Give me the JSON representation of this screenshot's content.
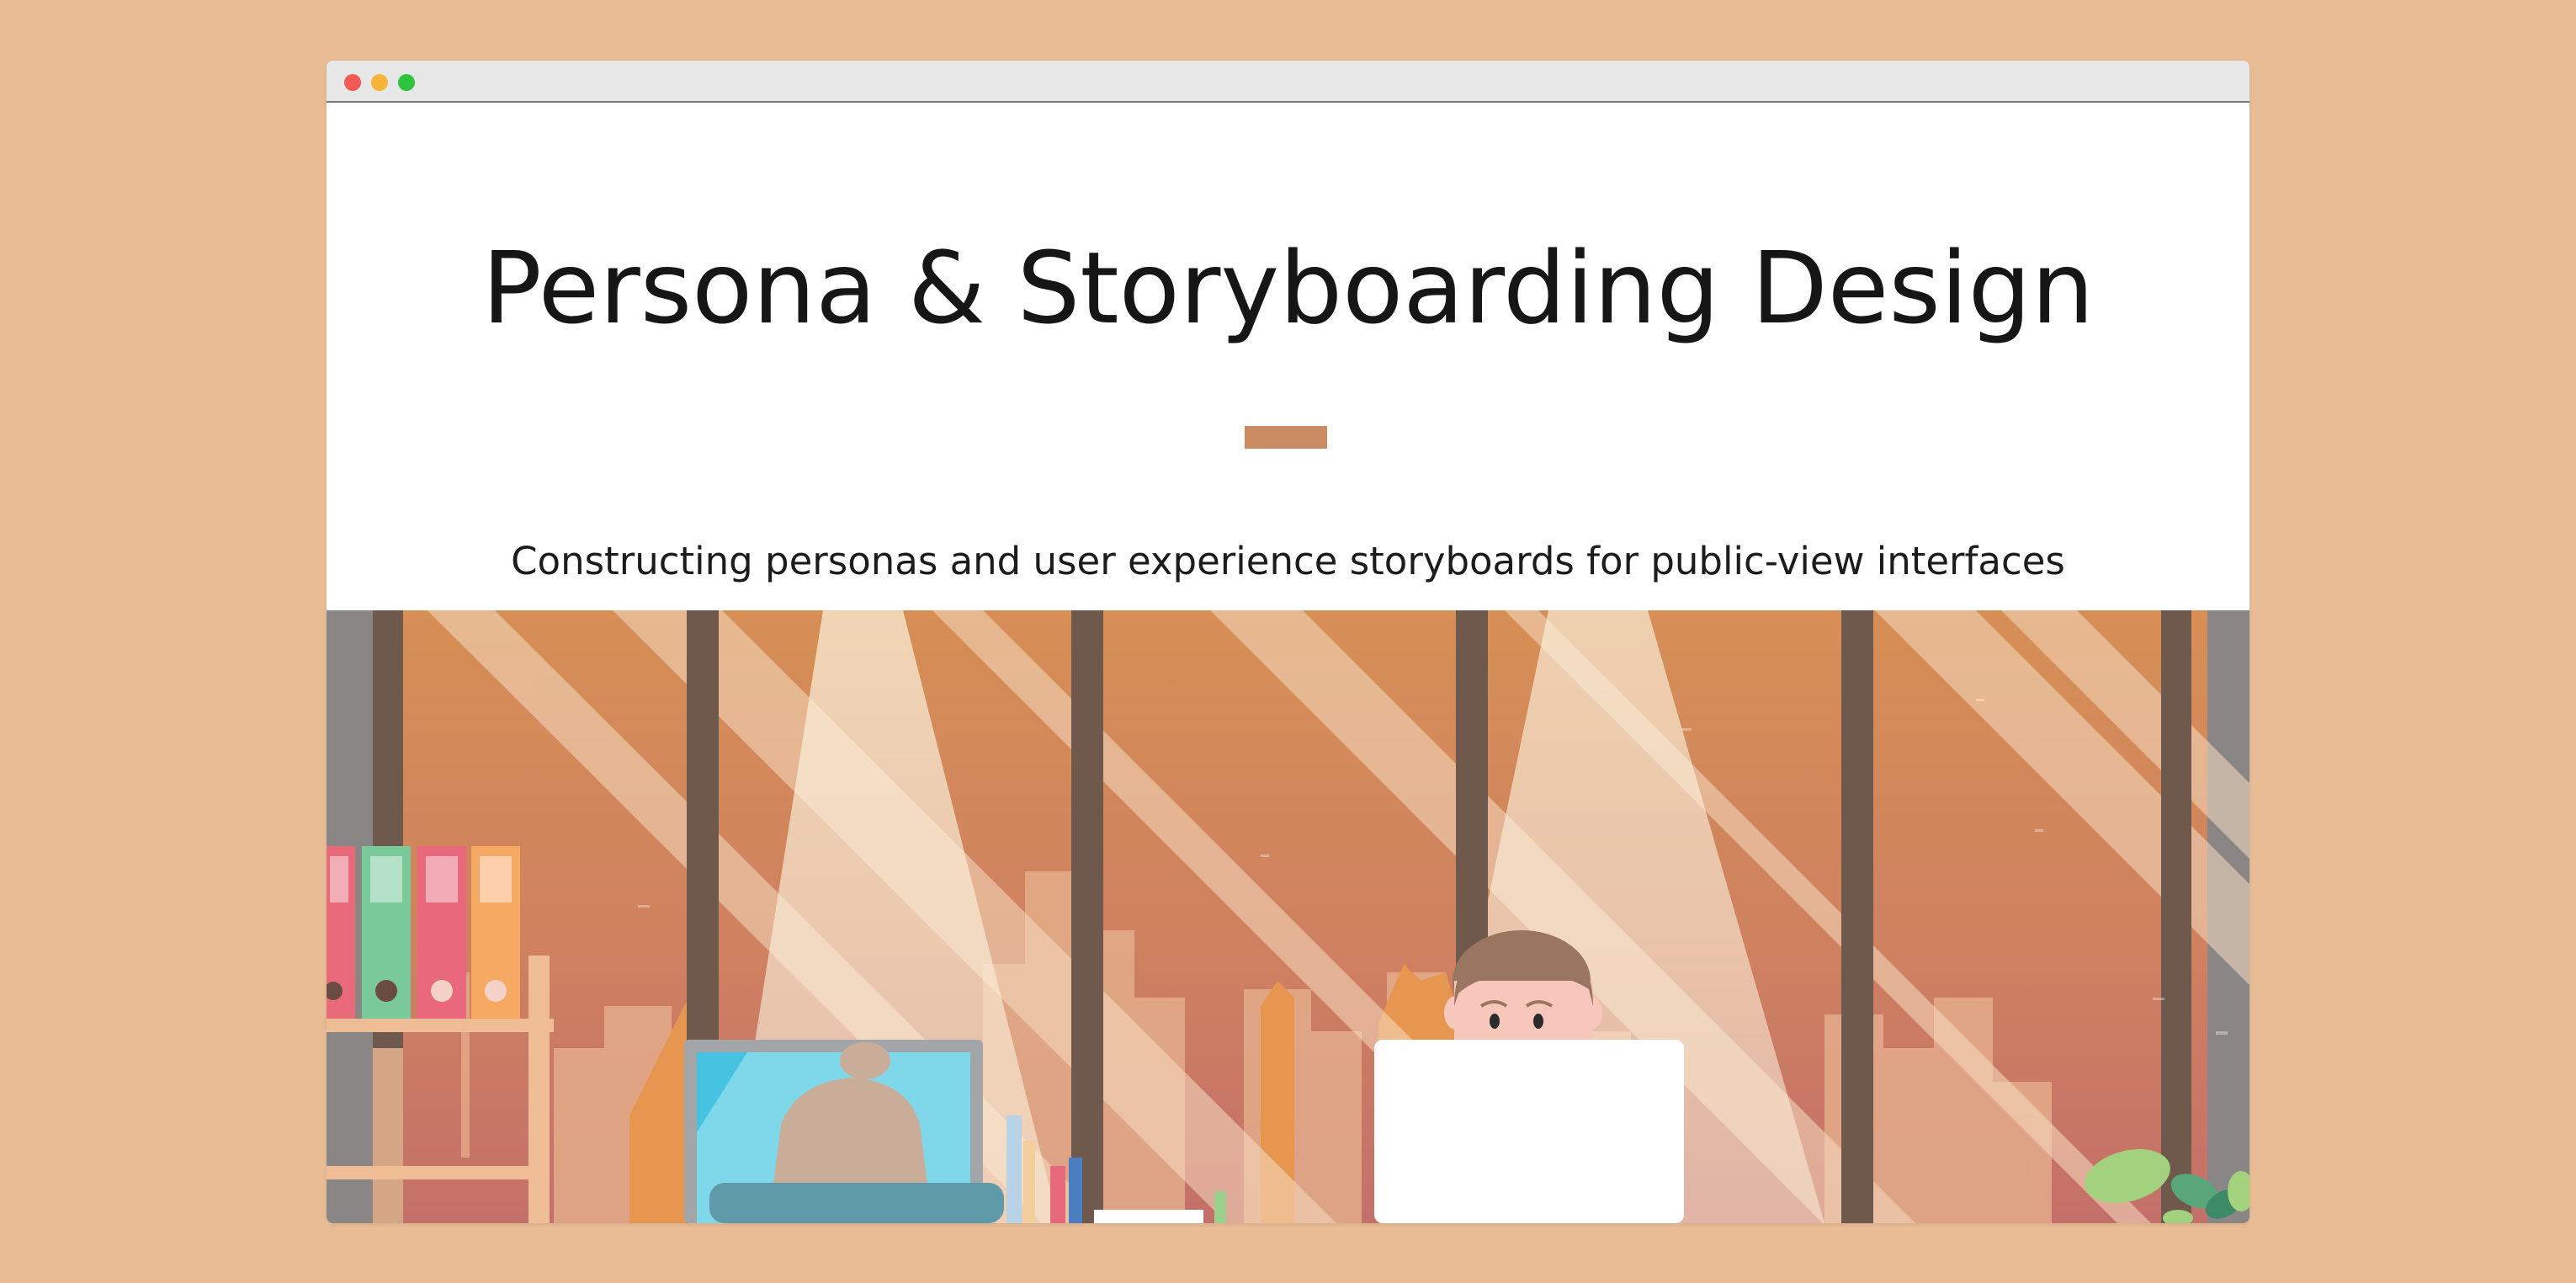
{
  "window": {
    "controls": [
      "close",
      "minimize",
      "maximize"
    ]
  },
  "hero": {
    "title": "Persona & Storyboarding Design",
    "subtitle": "Constructing personas and user experience storyboards for public-view interfaces"
  },
  "illustration": {
    "description_icon": "office-workers-illustration"
  },
  "colors": {
    "page_background": "#e8bd96",
    "accent": "#cb8b63",
    "titlebar": "#e8e7e8",
    "close": "#f25a55",
    "minimize": "#f7b33a",
    "maximize": "#2ec43f"
  }
}
